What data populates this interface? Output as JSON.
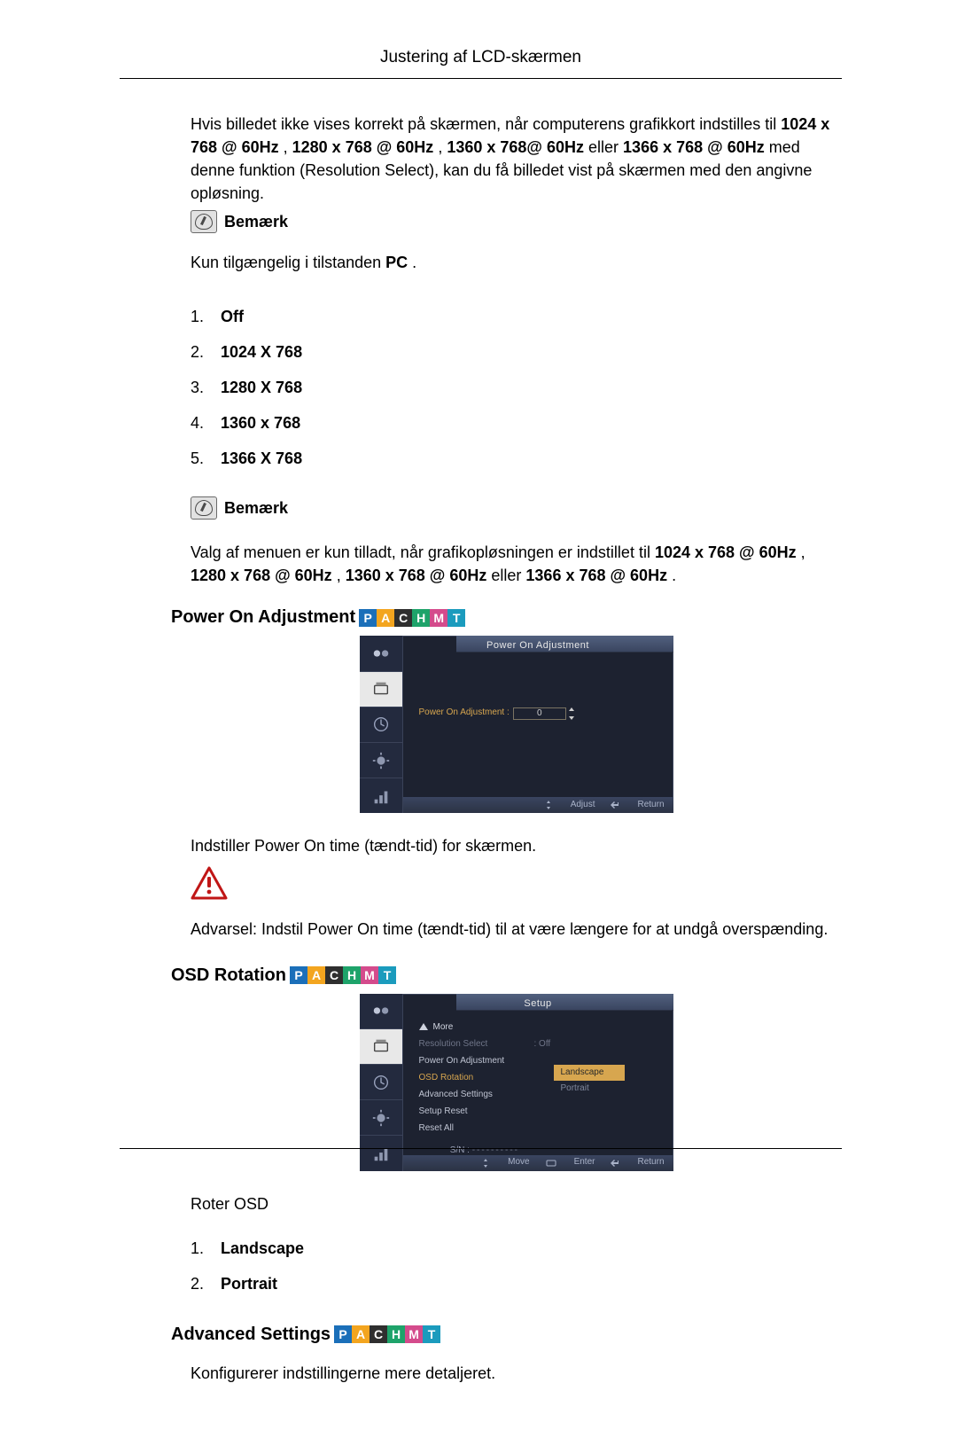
{
  "page_header": "Justering af LCD-skærmen",
  "res_select": {
    "intro_parts": {
      "p1": "Hvis billedet ikke vises korrekt på skærmen, når computerens grafikkort indstilles til ",
      "b1": "1024 x 768 @ 60Hz",
      "s1": ", ",
      "b2": "1280 x 768 @ 60Hz",
      "s2": ", ",
      "b3": "1360 x 768@ 60Hz",
      "s3": " eller ",
      "b4": "1366 x 768 @ 60Hz",
      "p2": " med denne funktion (Resolution Select), kan du få billedet vist på skærmen med den angivne opløsning."
    },
    "note1_label": "Bemærk",
    "note1_sentence_parts": {
      "a": "Kun tilgængelig i tilstanden ",
      "b": "PC",
      "c": "."
    },
    "items": [
      "Off",
      "1024 X 768",
      "1280 X 768",
      "1360 x 768",
      "1366 X 768"
    ],
    "note2_label": "Bemærk",
    "note2_sentence_parts": {
      "a": "Valg af menuen er kun tilladt, når grafikopløsningen er indstillet til ",
      "b1": "1024 x 768 @ 60Hz",
      "s1": ", ",
      "b2": "1280 x 768 @ 60Hz",
      "s2": ", ",
      "b3": "1360 x 768 @ 60Hz",
      "s3": " eller ",
      "b4": "1366 x 768 @ 60Hz",
      "c": "."
    }
  },
  "power_on": {
    "title": "Power On Adjustment",
    "osd_title": "Power On Adjustment",
    "osd_field_label": "Power On Adjustment :",
    "osd_value": "0",
    "foot_adjust": "Adjust",
    "foot_return": "Return",
    "desc": "Indstiller Power On time (tændt-tid) for skærmen.",
    "warning": "Advarsel: Indstil Power On time (tændt-tid) til at være længere for at undgå overspænding."
  },
  "osd_rotation": {
    "title": "OSD Rotation",
    "osd_title": "Setup",
    "menu": {
      "more": "More",
      "rows": [
        {
          "k": "Resolution Select",
          "v": ": Off",
          "dim": true
        },
        {
          "k": "Power On Adjustment",
          "v": "",
          "dim": false
        },
        {
          "k": "OSD Rotation",
          "v": "",
          "sel": true
        },
        {
          "k": "Advanced Settings",
          "v": "",
          "dim": false
        },
        {
          "k": "Setup Reset",
          "v": "",
          "dim": false
        },
        {
          "k": "Reset All",
          "v": "",
          "dim": false
        }
      ],
      "sn_label": "S/N :",
      "options": [
        "Landscape",
        "Portrait"
      ]
    },
    "foot_move": "Move",
    "foot_enter": "Enter",
    "foot_return": "Return",
    "desc": "Roter OSD",
    "items": [
      "Landscape",
      "Portrait"
    ]
  },
  "advanced": {
    "title": "Advanced Settings",
    "desc": "Konfigurerer indstillingerne mere detaljeret."
  },
  "badges": [
    "P",
    "A",
    "C",
    "H",
    "M",
    "T"
  ]
}
